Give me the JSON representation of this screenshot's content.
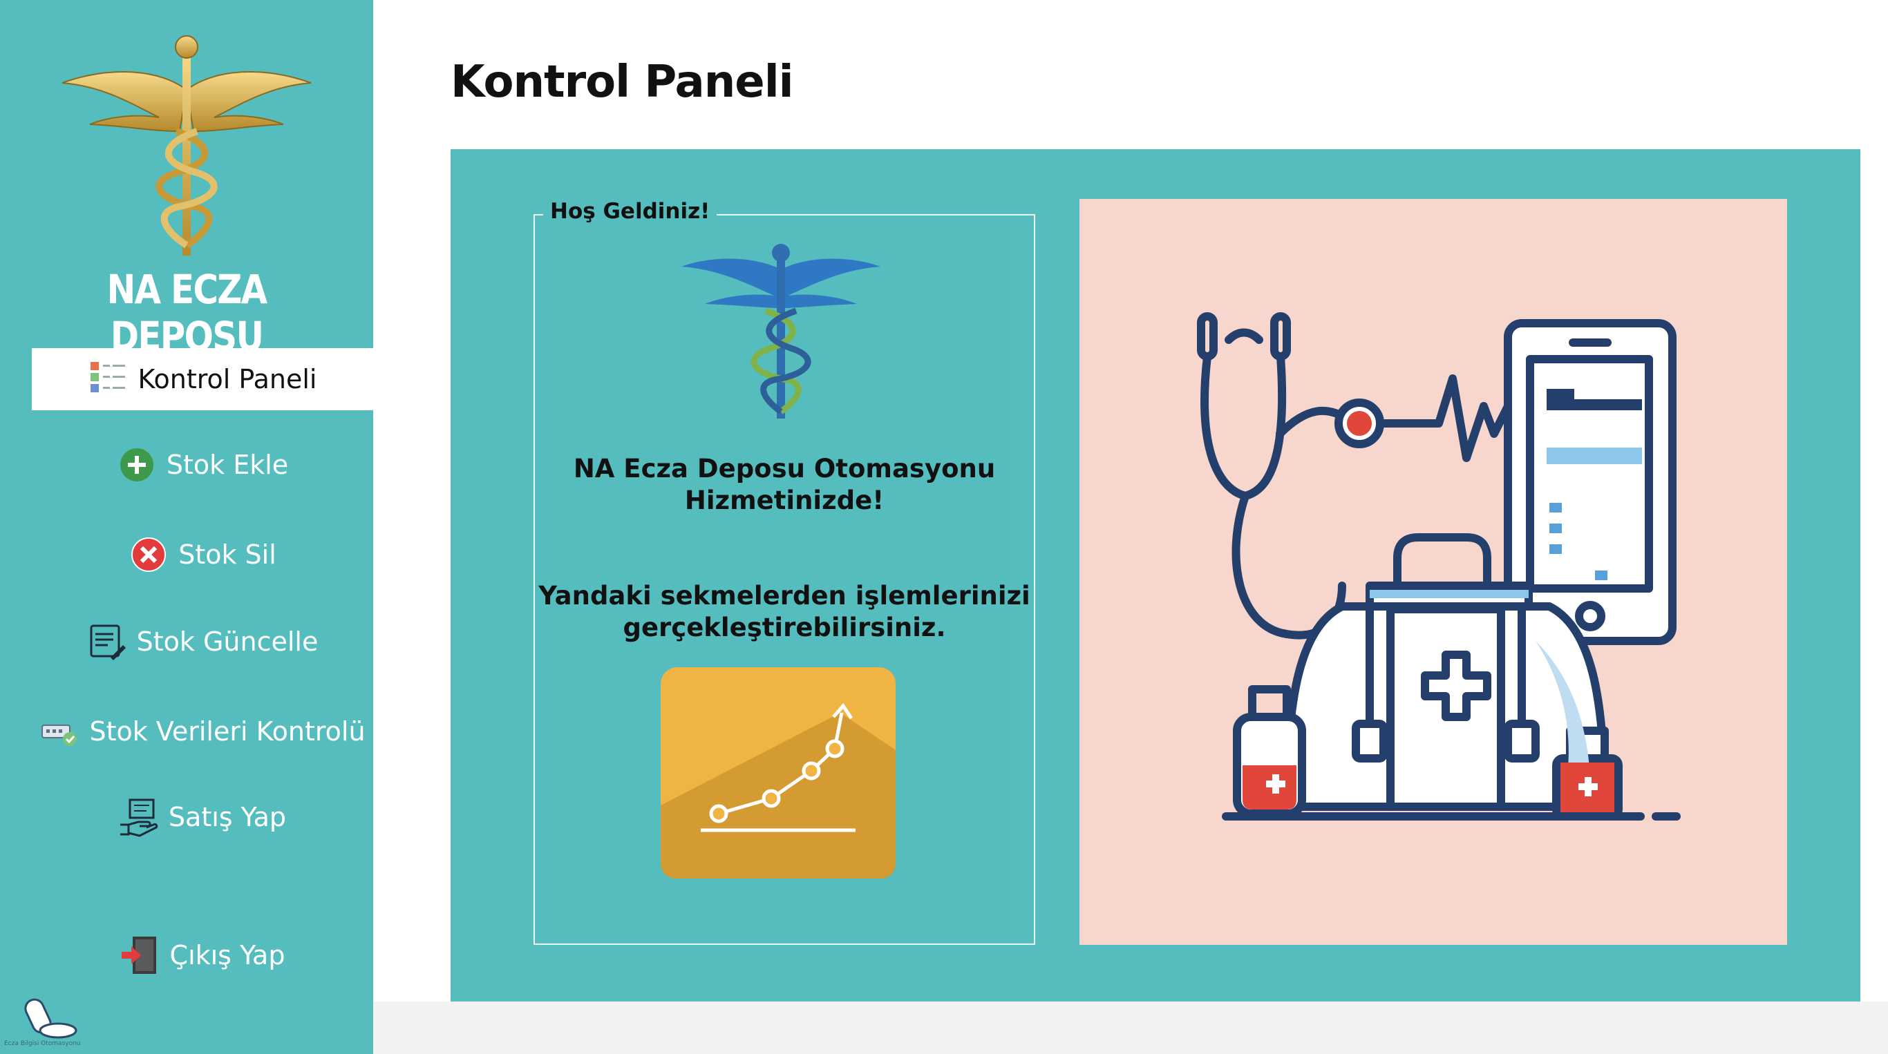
{
  "sidebar": {
    "brand": "NA ECZA DEPOSU",
    "items": [
      {
        "label": "Kontrol Paneli",
        "icon": "dashboard-list-icon",
        "active": true
      },
      {
        "label": "Stok Ekle",
        "icon": "plus-circle-icon"
      },
      {
        "label": "Stok Sil",
        "icon": "x-circle-icon"
      },
      {
        "label": "Stok Güncelle",
        "icon": "edit-document-icon"
      },
      {
        "label": "Stok Verileri Kontrolü",
        "icon": "data-check-icon"
      },
      {
        "label": "Satış Yap",
        "icon": "sale-hand-icon"
      },
      {
        "label": "Çıkış Yap",
        "icon": "exit-door-icon"
      }
    ],
    "footer_caption": "Ecza Bilgisi Otomasyonu"
  },
  "main": {
    "title": "Kontrol Paneli",
    "welcome": {
      "legend": "Hoş Geldiniz!",
      "line1": "NA Ecza Deposu Otomasyonu",
      "line2": "Hizmetinizde!",
      "line3": "Yandaki sekmelerden işlemlerinizi",
      "line4": "gerçekleştirebilirsiniz."
    }
  },
  "colors": {
    "sidebar": "#56bdbf",
    "panel": "#56bdbf",
    "illustration_bg": "#f6d6cd",
    "chart_card": "#efb443",
    "accent_red": "#e0473a",
    "navy": "#243f6b"
  }
}
